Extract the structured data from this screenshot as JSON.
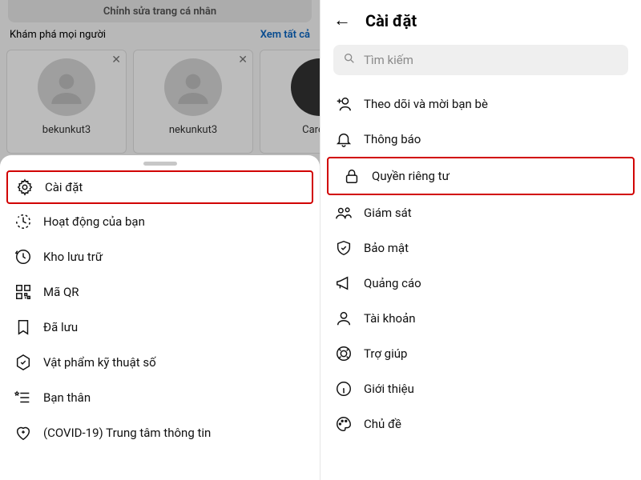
{
  "left": {
    "profile_edit": "Chỉnh sửa trang cá nhân",
    "discover": "Khám phá mọi người",
    "see_all": "Xem tất cả",
    "suggestions": [
      {
        "name": "bekunkut3"
      },
      {
        "name": "nekunkut3"
      },
      {
        "name": "Carolyn"
      }
    ],
    "sheet": {
      "settings": "Cài đặt",
      "activity": "Hoạt động của bạn",
      "archive": "Kho lưu trữ",
      "qr": "Mã QR",
      "saved": "Đã lưu",
      "digital": "Vật phẩm kỹ thuật số",
      "close_friends": "Bạn thân",
      "covid": "(COVID-19) Trung tâm thông tin"
    }
  },
  "right": {
    "title": "Cài đặt",
    "search_placeholder": "Tìm kiếm",
    "items": {
      "follow_invite": "Theo dõi và mời bạn bè",
      "notifications": "Thông báo",
      "privacy": "Quyền riêng tư",
      "supervision": "Giám sát",
      "security": "Bảo mật",
      "ads": "Quảng cáo",
      "account": "Tài khoản",
      "help": "Trợ giúp",
      "about": "Giới thiệu",
      "theme": "Chủ đề"
    }
  }
}
